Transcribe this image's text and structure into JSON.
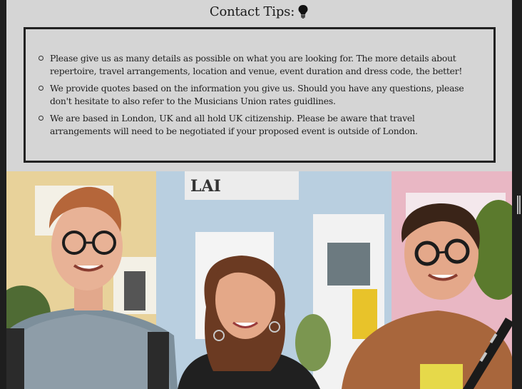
{
  "contact_tips": {
    "title": "Contact Tips:",
    "icon": "lightbulb-icon",
    "items": [
      {
        "text": "Please give us as many details as possible on what you are looking for. The more details about repertoire, travel arrangements, location and venue, event duration and dress code, the better!"
      },
      {
        "text": "We provide quotes based on the information you give us. Should you have any questions, please don't hesitate to also refer to the Musicians Union rates guidlines."
      },
      {
        "text": "We are based in London, UK and all hold UK citizenship. Please be aware that travel arrangements will need to be negotiated if your proposed event is outside of London."
      }
    ]
  },
  "photo": {
    "subject": "three-musicians-photo"
  },
  "colors": {
    "panel_bg": "#d5d5d5",
    "border": "#222222",
    "outer_bg": "#1e1e1e"
  }
}
